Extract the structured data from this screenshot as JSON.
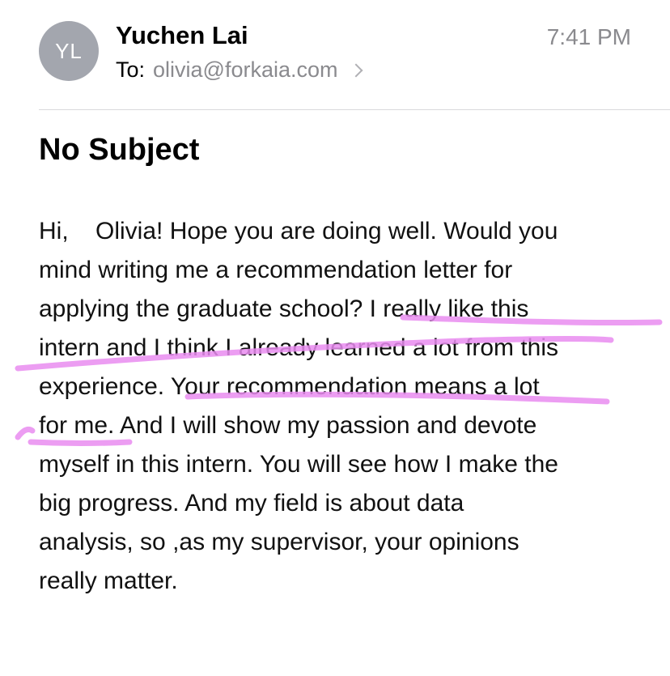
{
  "header": {
    "avatar_initials": "YL",
    "sender_name": "Yuchen Lai",
    "time": "7:41 PM",
    "to_label": "To:",
    "recipient": "olivia@forkaia.com"
  },
  "subject": "No Subject",
  "body_lines": [
    "Hi,    Olivia! Hope you are doing well. Would you",
    "mind writing me a recommendation letter for",
    "applying the graduate school? I really like this",
    "intern and I think I already learned a lot from this",
    "experience. Your recommendation means a lot",
    "for me. And I will show my passion and devote",
    "myself in this intern. You will see how I make the",
    "big progress. And my field is about data",
    "analysis, so ,as my supervisor, your opinions",
    "really matter."
  ],
  "colors": {
    "highlight": "#e98cf0",
    "avatar_bg": "#a3a6ae",
    "secondary_text": "#8a8a8e"
  }
}
